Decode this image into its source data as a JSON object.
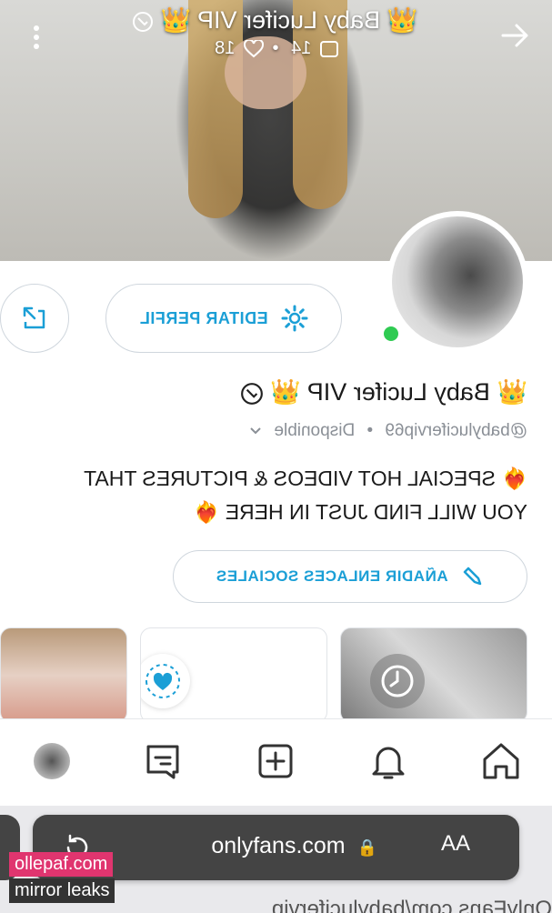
{
  "header": {
    "title": "Baby Lucifer VIP",
    "title_emoji": "👑",
    "media_count": "14",
    "likes_count": "18",
    "separator": "•"
  },
  "profile": {
    "name": "Baby Lucifer VIP",
    "crown": "👑",
    "handle": "@babylucifervip69",
    "status_separator": "•",
    "status": "Disponible",
    "bio_line1": "SPECIAL HOT VIDEOS & PICTURES THAT",
    "bio_line2": "YOU WILL FIND JUST IN HERE",
    "bio_emoji": "❤️‍🔥"
  },
  "buttons": {
    "edit_profile": "EDITAR PERFIL",
    "add_social": "AÑADIR ENLACES SOCIALES"
  },
  "browser": {
    "text_size": "AA",
    "url": "onlyfans.com",
    "bottom_text": "OnlyFans.com/babylucifervip"
  },
  "watermark": {
    "line1": "ollepaf.com",
    "line2": "mirror leaks"
  },
  "colors": {
    "accent": "#1b9fd6",
    "online": "#2fcb52"
  }
}
